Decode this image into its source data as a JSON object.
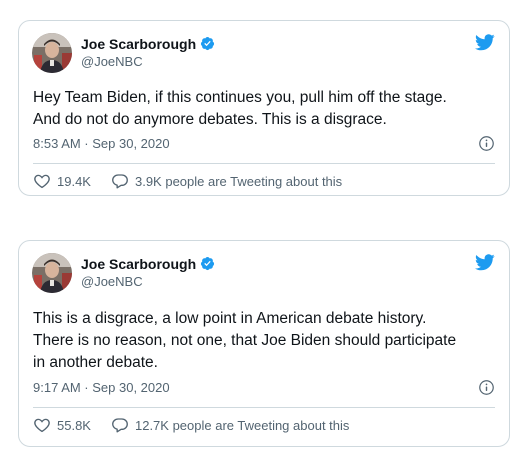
{
  "tweets": [
    {
      "display_name": "Joe Scarborough",
      "handle": "@JoeNBC",
      "text": "Hey Team Biden, if this continues you, pull him off the stage.\nAnd do not do anymore debates. This is a disgrace.",
      "timestamp": "8:53 AM · Sep 30, 2020",
      "likes": "19.4K",
      "conversation": "3.9K people are Tweeting about this"
    },
    {
      "display_name": "Joe Scarborough",
      "handle": "@JoeNBC",
      "text": "This is a disgrace, a low point in American debate history.\nThere is no reason, not one, that Joe Biden should participate\nin another debate.",
      "timestamp": "9:17 AM · Sep 30, 2020",
      "likes": "55.8K",
      "conversation": "12.7K people are Tweeting about this"
    }
  ],
  "icons": {
    "verified": "verified-badge-icon",
    "brand": "twitter-bird-icon",
    "info": "info-icon",
    "like": "heart-icon",
    "reply": "speech-bubble-icon"
  },
  "colors": {
    "brand_blue": "#1d9bf0",
    "text_primary": "#0f1419",
    "text_secondary": "#536471",
    "border": "#cfd9de"
  }
}
